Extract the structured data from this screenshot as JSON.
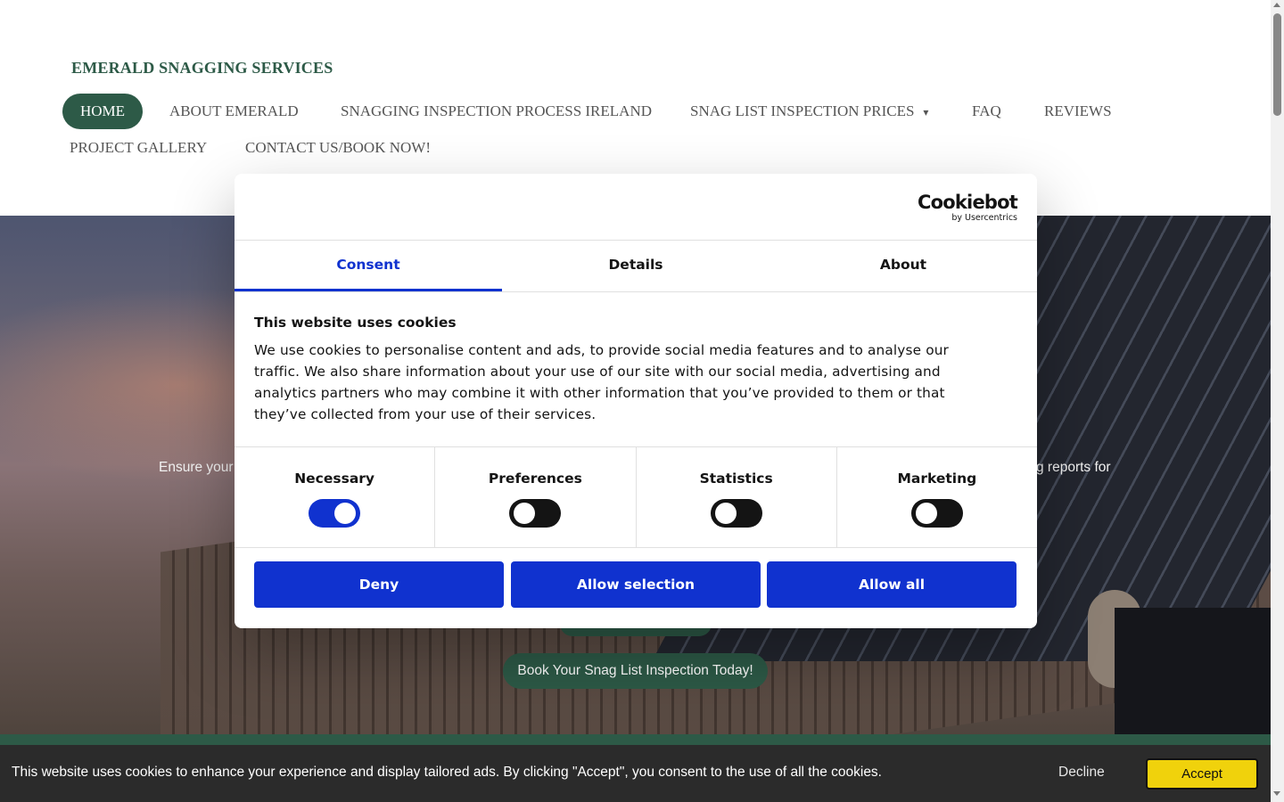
{
  "site": {
    "brand": "EMERALD SNAGGING SERVICES",
    "nav": {
      "home": "HOME",
      "about": "ABOUT EMERALD",
      "process": "SNAGGING INSPECTION PROCESS IRELAND",
      "prices": "SNAG LIST INSPECTION PRICES",
      "prices_caret": "▾",
      "faq": "FAQ",
      "reviews": "REVIEWS",
      "gallery": "PROJECT GALLERY",
      "contact": "CONTACT US/BOOK NOW!"
    },
    "hero": {
      "text_left": "Ensure your",
      "text_right": "g reports for",
      "cta": "Book Your Snag List Inspection Today!"
    }
  },
  "cookie_bar": {
    "message": "This website uses cookies to enhance your experience and display tailored ads. By clicking \"Accept\", you consent to the use of all the cookies.",
    "decline": "Decline",
    "accept": "Accept",
    "accept_color": "#f0d20c"
  },
  "cookiebot": {
    "logo": "Cookiebot",
    "logo_sub": "by Usercentrics",
    "tabs": {
      "consent": "Consent",
      "details": "Details",
      "about": "About"
    },
    "active_tab": "Consent",
    "title": "This website uses cookies",
    "body": "We use cookies to personalise content and ads, to provide social media features and to analyse our traffic. We also share information about your use of our site with our social media, advertising and analytics partners who may combine it with other information that you’ve provided to them or that they’ve collected from your use of their services.",
    "toggles": {
      "necessary": {
        "label": "Necessary",
        "on": true
      },
      "preferences": {
        "label": "Preferences",
        "on": false
      },
      "statistics": {
        "label": "Statistics",
        "on": false
      },
      "marketing": {
        "label": "Marketing",
        "on": false
      }
    },
    "buttons": {
      "deny": "Deny",
      "allow_selection": "Allow selection",
      "allow_all": "Allow all"
    },
    "accent_color": "#1032cf"
  },
  "colors": {
    "brand_green": "#2d5a47"
  }
}
